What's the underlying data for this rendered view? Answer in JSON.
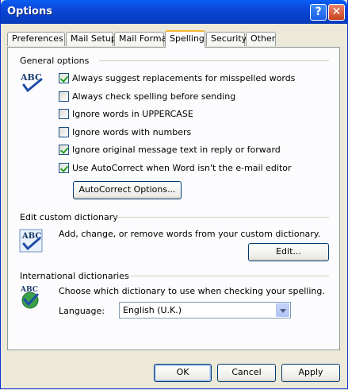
{
  "window": {
    "title": "Options"
  },
  "tabs": [
    {
      "label": "Preferences"
    },
    {
      "label": "Mail Setup"
    },
    {
      "label": "Mail Format"
    },
    {
      "label": "Spelling"
    },
    {
      "label": "Security"
    },
    {
      "label": "Other"
    }
  ],
  "active_tab": "Spelling",
  "general": {
    "label": "General options",
    "options": [
      {
        "label": "Always suggest replacements for misspelled words",
        "checked": true
      },
      {
        "label": "Always check spelling before sending",
        "checked": false
      },
      {
        "label": "Ignore words in UPPERCASE",
        "checked": false
      },
      {
        "label": "Ignore words with numbers",
        "checked": false
      },
      {
        "label": "Ignore original message text in reply or forward",
        "checked": true
      },
      {
        "label": "Use AutoCorrect when Word isn't the e-mail editor",
        "checked": true
      }
    ],
    "autocorrect_button": "AutoCorrect Options..."
  },
  "custom_dict": {
    "label": "Edit custom dictionary",
    "description": "Add, change, or remove words from your custom dictionary.",
    "edit_button": "Edit..."
  },
  "intl": {
    "label": "International dictionaries",
    "description": "Choose which dictionary to use when checking your spelling.",
    "language_label": "Language:",
    "language_value": "English (U.K.)"
  },
  "footer": {
    "ok": "OK",
    "cancel": "Cancel",
    "apply": "Apply"
  },
  "icons": {
    "abc_text": "ABC"
  },
  "colors": {
    "titlebar": "#0a46d8",
    "accent_tab": "#f8b636",
    "checkmark": "#21a121",
    "window_bg": "#ece9d8"
  }
}
